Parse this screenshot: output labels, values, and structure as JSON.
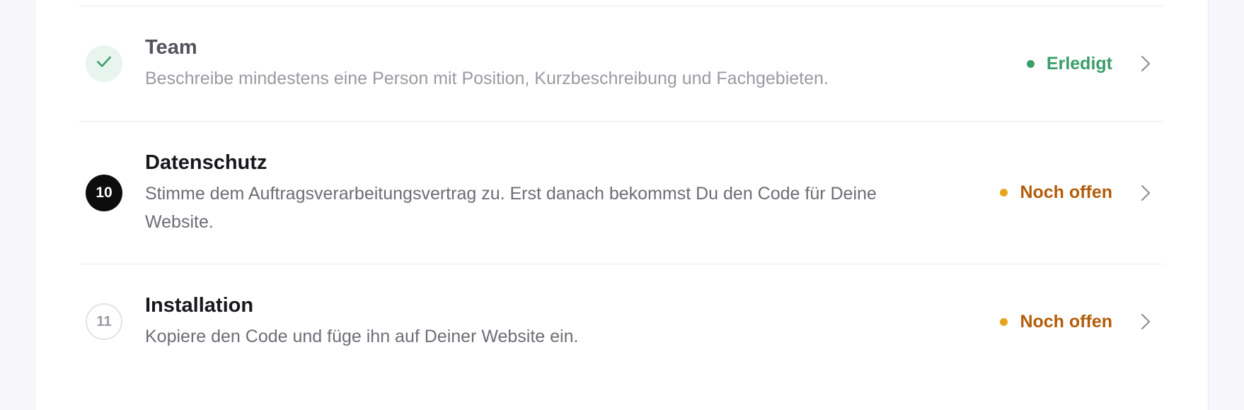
{
  "steps": [
    {
      "marker": "",
      "marker_icon": "check-icon",
      "state": "done",
      "title": "Team",
      "description": "Beschreibe mindestens eine Person mit Position, Kurzbeschreibung und Fachgebieten.",
      "status": "Erledigt",
      "status_color": "#3a9e6a"
    },
    {
      "marker": "10",
      "state": "current",
      "title": "Datenschutz",
      "description": "Stimme dem Auftragsverarbeitungsvertrag zu. Erst danach bekommst Du den Code für Deine Website.",
      "status": "Noch offen",
      "status_color": "#b25d09",
      "status_dot_color": "#e8a31a"
    },
    {
      "marker": "11",
      "state": "pending",
      "title": "Installation",
      "description": "Kopiere den Code und füge ihn auf Deiner Website ein.",
      "status": "Noch offen",
      "status_color": "#b25d09",
      "status_dot_color": "#e8a31a"
    }
  ],
  "colors": {
    "done_green": "#3a9e6a",
    "open_orange": "#b25d09",
    "open_dot": "#e8a31a"
  },
  "icons": {
    "check": "check-icon",
    "chevron": "chevron-right-icon"
  }
}
